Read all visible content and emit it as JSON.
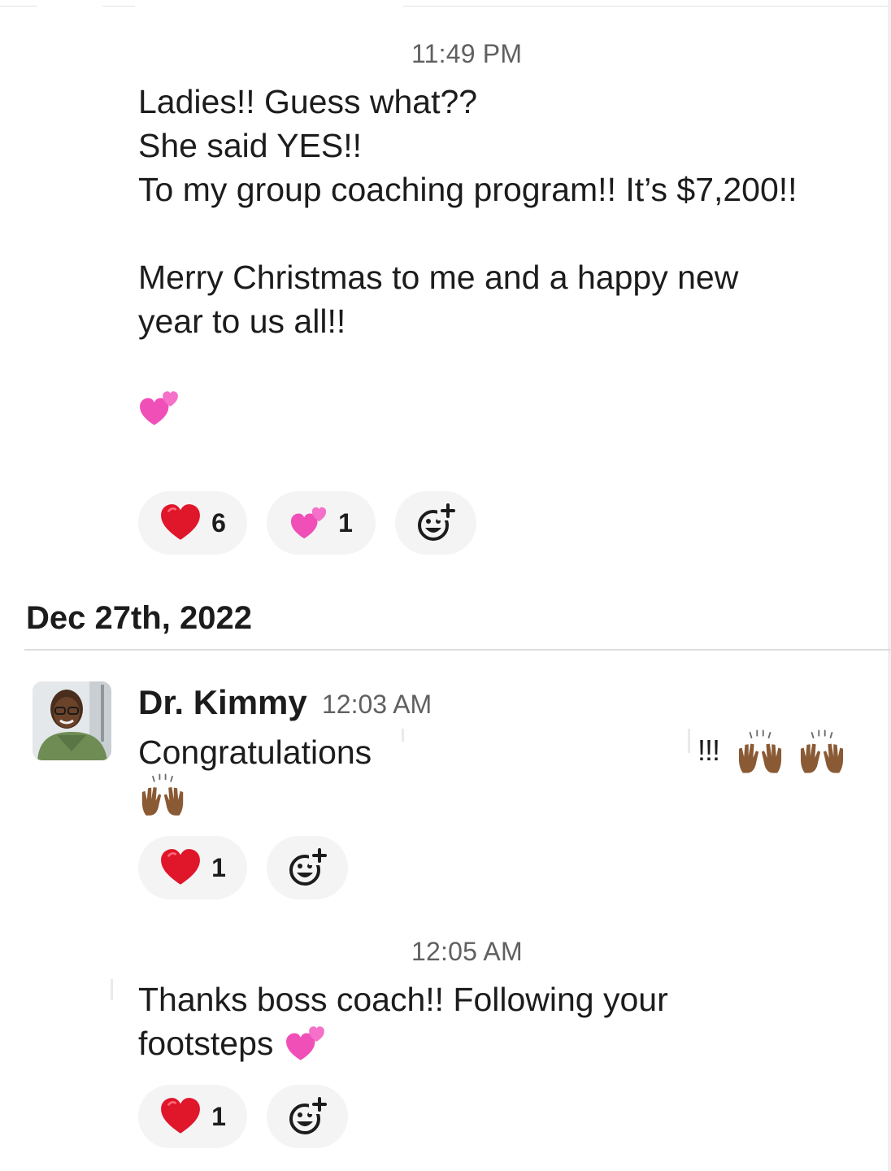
{
  "message1": {
    "timestamp": "11:49 PM",
    "lines": [
      "Ladies!! Guess what??",
      "She said YES!!",
      "To my group coaching program!! It’s $7,200!!",
      "",
      "Merry Christmas to me and a happy new",
      "year to us all!!"
    ],
    "trailing_emoji": "two-hearts-icon",
    "reactions": [
      {
        "emoji": "red-heart-icon",
        "count": "6"
      },
      {
        "emoji": "two-hearts-icon",
        "count": "1"
      }
    ]
  },
  "date_divider": "Dec 27th, 2022",
  "message2": {
    "sender": "Dr. Kimmy",
    "timestamp": "12:03 AM",
    "text": "Congratulations",
    "trailing_text": "!!!",
    "reactions": [
      {
        "emoji": "red-heart-icon",
        "count": "1"
      }
    ]
  },
  "message3": {
    "timestamp": "12:05 AM",
    "line1": "Thanks boss coach!! Following your",
    "line2": "footsteps",
    "reactions": [
      {
        "emoji": "red-heart-icon",
        "count": "1"
      }
    ]
  },
  "colors": {
    "heart": "#e0162b",
    "pink_heart": "#f04fb8",
    "reaction_bg": "#f4f4f4",
    "timestamp": "#616061",
    "text": "#1d1c1d"
  }
}
